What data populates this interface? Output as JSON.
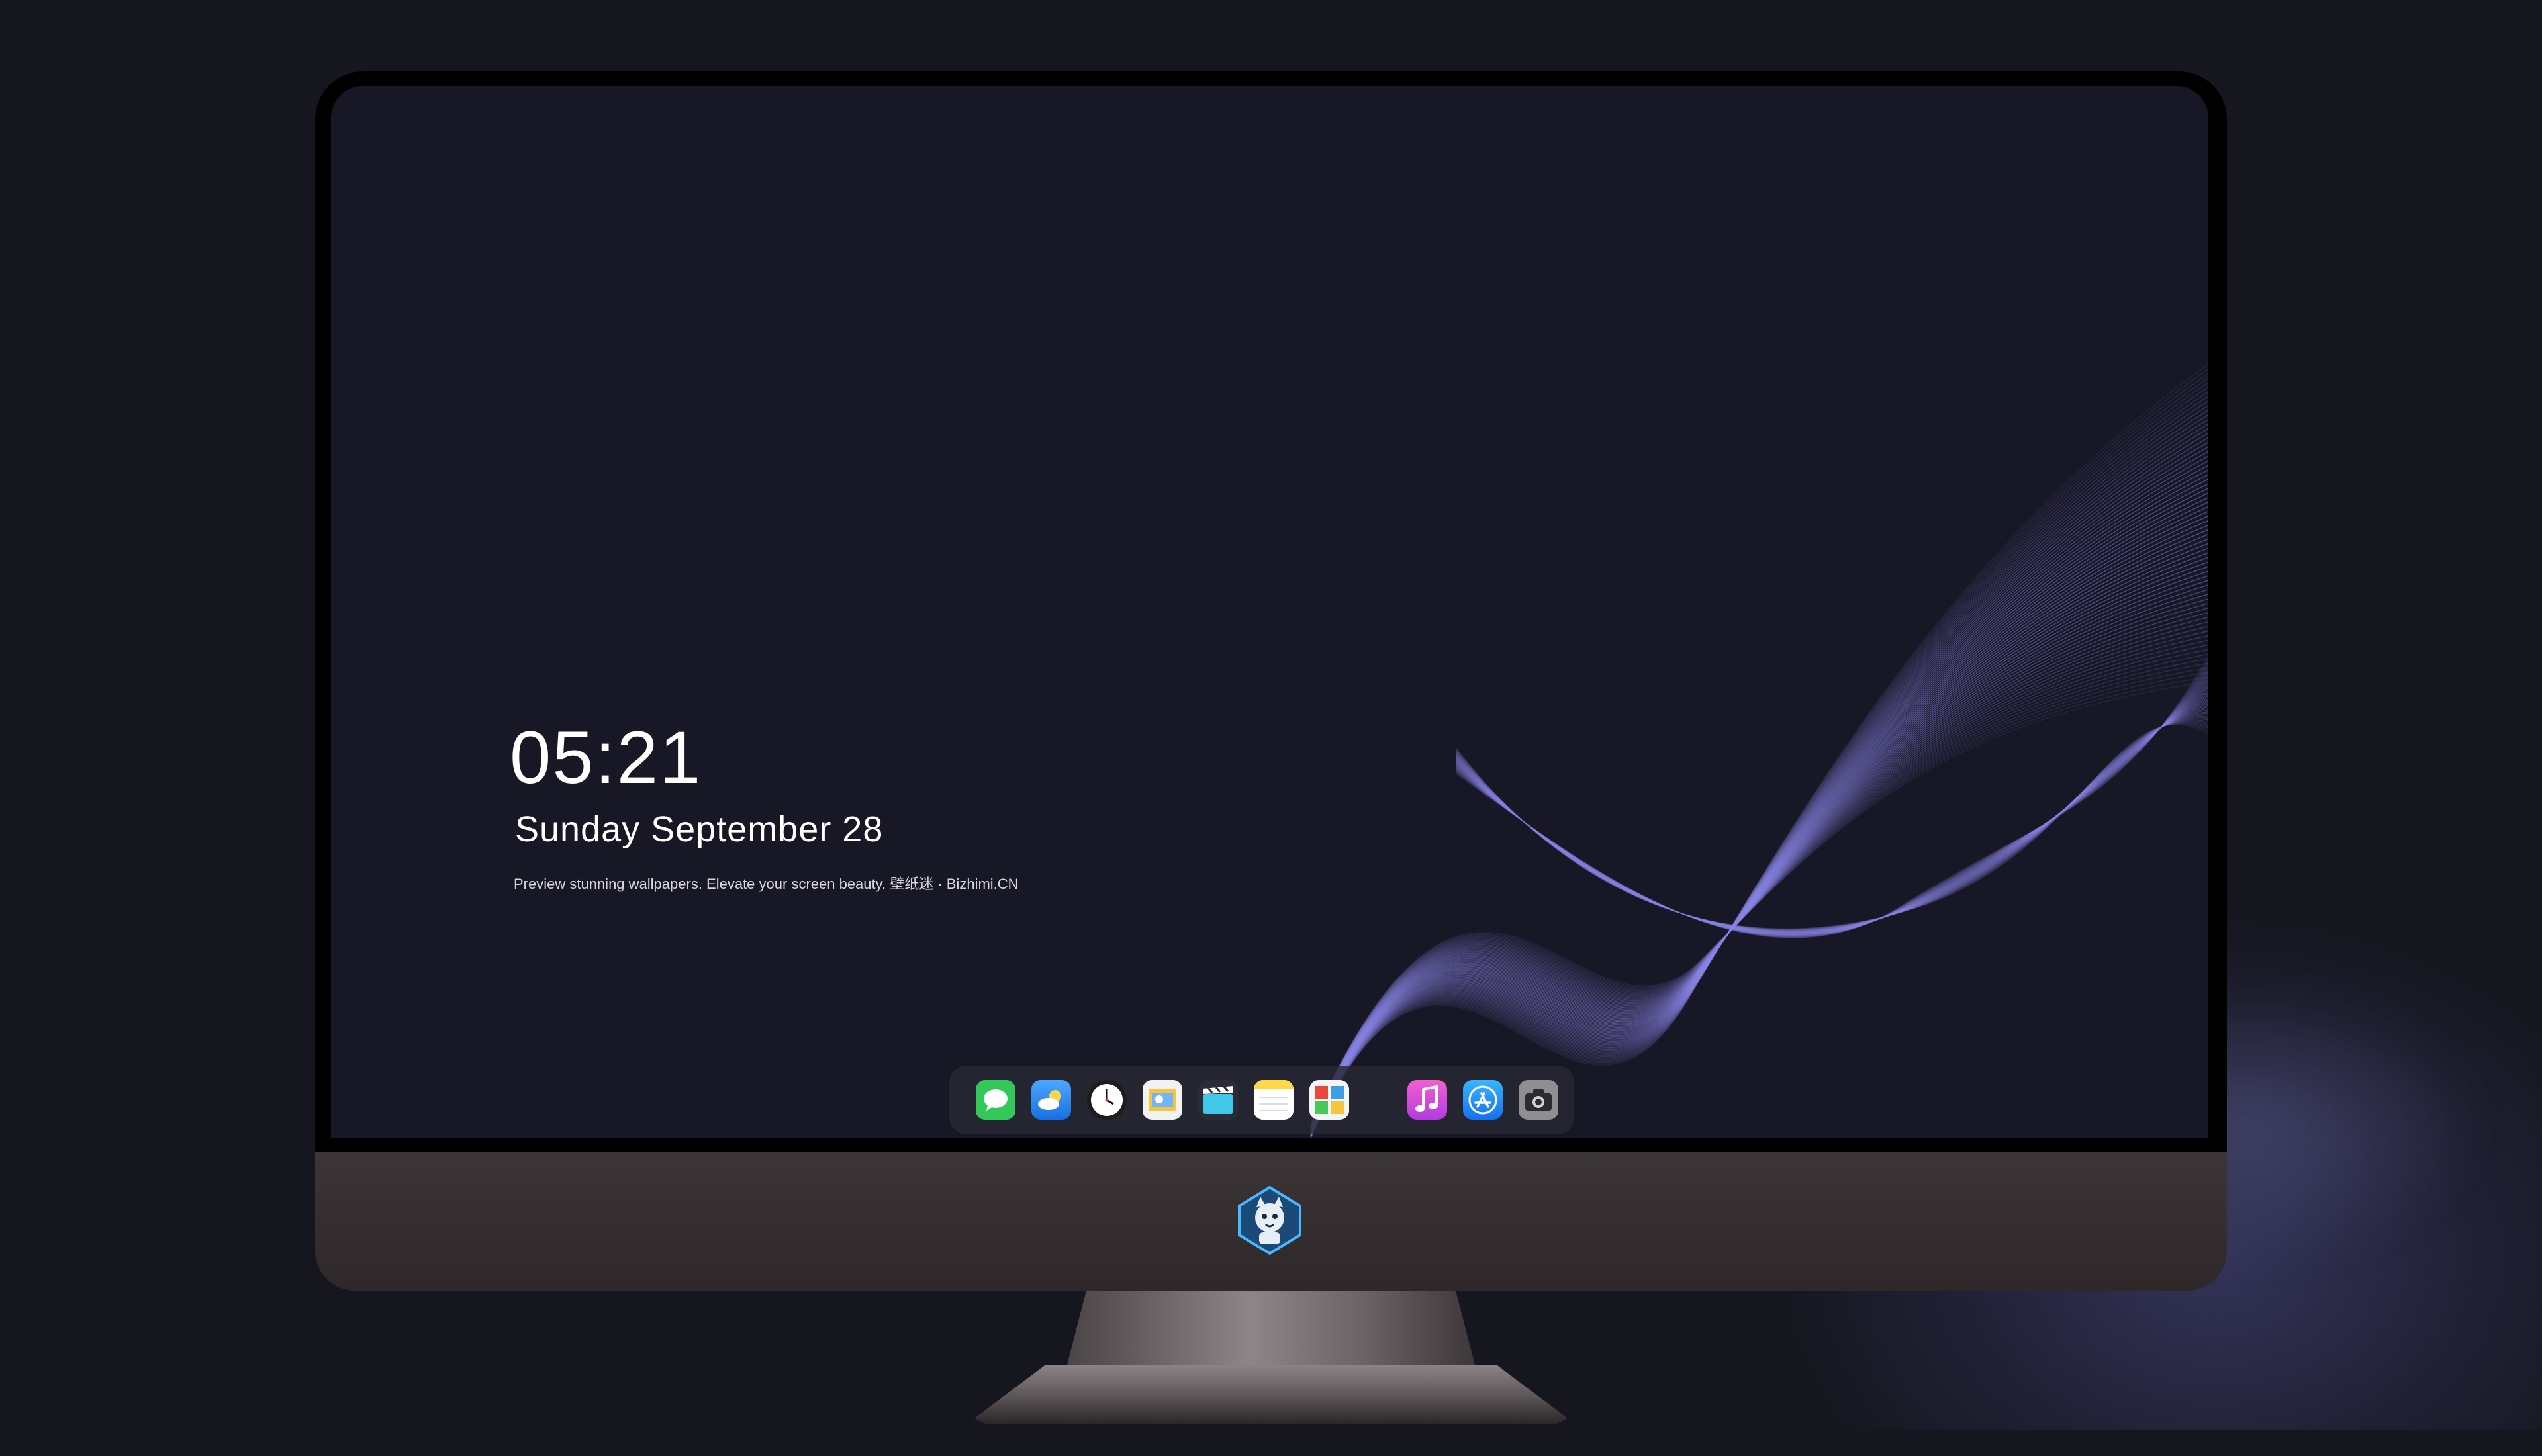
{
  "lock_screen": {
    "time": "05:21",
    "date": "Sunday September  28",
    "tagline": "Preview stunning wallpapers. Elevate your screen beauty. 壁纸迷 · Bizhimi.CN"
  },
  "dock": {
    "items": [
      {
        "name": "messages-icon",
        "color": "#34c759"
      },
      {
        "name": "weather-icon",
        "color": "#2a8cf0"
      },
      {
        "name": "clock-icon",
        "color": "#ffffff"
      },
      {
        "name": "preview-icon",
        "color": "#f5c542"
      },
      {
        "name": "clips-icon",
        "color": "#3fc8e8"
      },
      {
        "name": "notes-icon",
        "color": "#ffd84a"
      },
      {
        "name": "photo-booth-icon",
        "color": "#e84a3a"
      },
      {
        "name": "music-icon",
        "color": "#e23cd6"
      },
      {
        "name": "app-store-icon",
        "color": "#1e90ff"
      },
      {
        "name": "camera-icon",
        "color": "#8e8e93"
      }
    ]
  },
  "colors": {
    "screen_background": "#181725",
    "wave_accent": "#8a86e8"
  }
}
